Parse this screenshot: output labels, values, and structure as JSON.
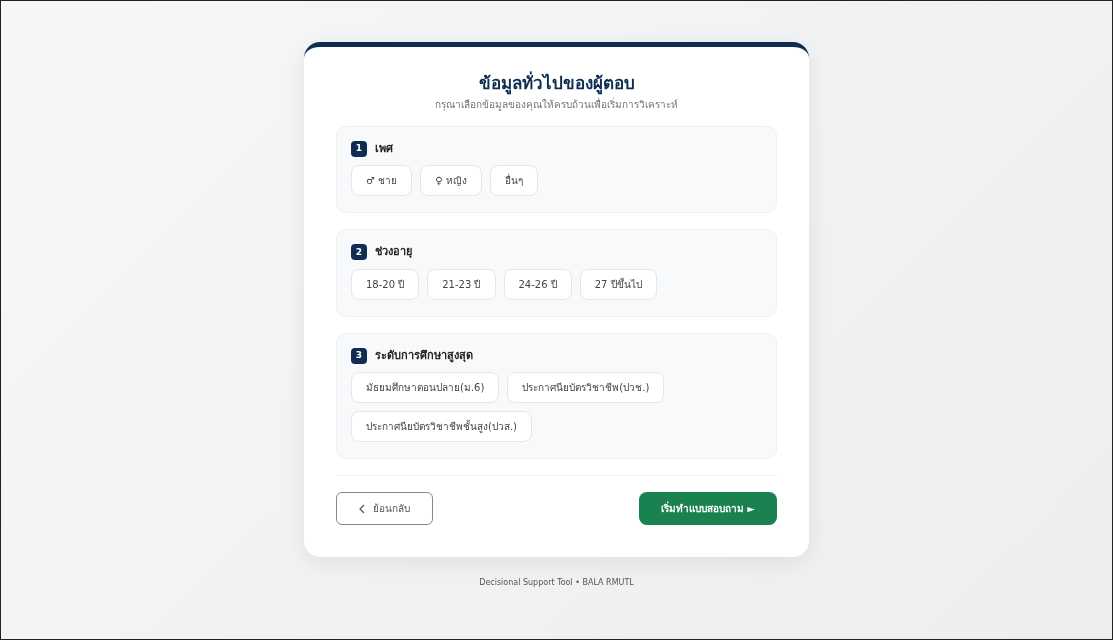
{
  "title": "ข้อมูลทั่วไปของผู้ตอบ",
  "subtitle": "กรุณาเลือกข้อมูลของคุณให้ครบถ้วนเพื่อเริ่มการวิเคราะห์",
  "sections": [
    {
      "number": "1",
      "title": "เพศ",
      "options": [
        {
          "symbol": "♂",
          "label": "ชาย",
          "selected": false
        },
        {
          "symbol": "♀",
          "label": "หญิง",
          "selected": false
        },
        {
          "label": "อื่นๆ",
          "selected": false
        }
      ]
    },
    {
      "number": "2",
      "title": "ช่วงอายุ",
      "options": [
        {
          "label": "18-20 ปี",
          "selected": false
        },
        {
          "label": "21-23 ปี",
          "selected": false
        },
        {
          "label": "24-26 ปี",
          "selected": false
        },
        {
          "label": "27 ปีขึ้นไป",
          "selected": false
        }
      ]
    },
    {
      "number": "3",
      "title": "ระดับการศึกษาสูงสุด",
      "options": [
        {
          "label": "มัธยมศึกษาตอนปลาย(ม.6)",
          "selected": false
        },
        {
          "label": "ประกาศนียบัตรวิชาชีพ(ปวช.)",
          "selected": false
        },
        {
          "label": "ประกาศนียบัตรวิชาชีพชั้นสูง(ปวส.)",
          "selected": false
        }
      ]
    }
  ],
  "back_button": "ย้อนกลับ",
  "start_button": "เริ่มทำแบบสอบถาม ►",
  "footer": "Decisional Support Tool • BALA RMUTL"
}
